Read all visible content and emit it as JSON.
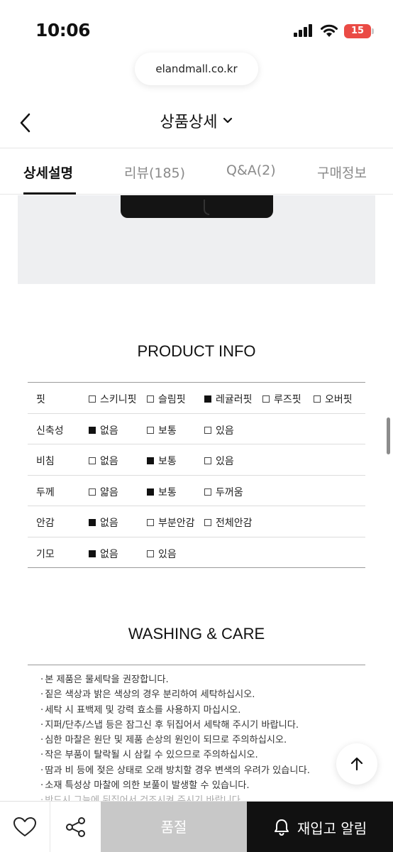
{
  "status_bar": {
    "time": "10:06",
    "battery": "15"
  },
  "browser": {
    "url": "elandmall.co.kr"
  },
  "header": {
    "title": "상품상세"
  },
  "tabs": [
    {
      "label": "상세설명",
      "active": true
    },
    {
      "label": "리뷰(185)",
      "active": false
    },
    {
      "label": "Q&A(2)",
      "active": false
    },
    {
      "label": "구매정보",
      "active": false
    }
  ],
  "product_info": {
    "title": "PRODUCT INFO",
    "rows": [
      {
        "label": "핏",
        "options": [
          {
            "text": "스키니핏",
            "checked": false
          },
          {
            "text": "슬림핏",
            "checked": false
          },
          {
            "text": "레귤러핏",
            "checked": true
          },
          {
            "text": "루즈핏",
            "checked": false
          },
          {
            "text": "오버핏",
            "checked": false
          }
        ]
      },
      {
        "label": "신축성",
        "options": [
          {
            "text": "없음",
            "checked": true
          },
          {
            "text": "보통",
            "checked": false
          },
          {
            "text": "있음",
            "checked": false
          }
        ]
      },
      {
        "label": "비침",
        "options": [
          {
            "text": "없음",
            "checked": false
          },
          {
            "text": "보통",
            "checked": true
          },
          {
            "text": "있음",
            "checked": false
          }
        ]
      },
      {
        "label": "두께",
        "options": [
          {
            "text": "얇음",
            "checked": false
          },
          {
            "text": "보통",
            "checked": true
          },
          {
            "text": "두꺼움",
            "checked": false
          }
        ]
      },
      {
        "label": "안감",
        "options": [
          {
            "text": "없음",
            "checked": true
          },
          {
            "text": "부분안감",
            "checked": false
          },
          {
            "text": "전체안감",
            "checked": false
          }
        ]
      },
      {
        "label": "기모",
        "options": [
          {
            "text": "없음",
            "checked": true
          },
          {
            "text": "있음",
            "checked": false
          }
        ]
      }
    ]
  },
  "washing": {
    "title": "WASHING & CARE",
    "items": [
      "본 제품은 물세탁을 권장합니다.",
      "짙은 색상과 밝은 색상의 경우 분리하여 세탁하십시오.",
      "세탁 시 표백제 및 강력 효소를 사용하지 마십시오.",
      "지퍼/단추/스냅 등은 잠그신 후 뒤집어서 세탁해 주시기 바랍니다.",
      "심한 마찰은 원단 및 제품 손상의 원인이 되므로 주의하십시오.",
      "작은 부품이 탈락될 시 삼킬 수 있으므로 주의하십시오.",
      "땀과 비 등에 젖은 상태로 오래 방치할 경우 변색의 우려가 있습니다.",
      "소재 특성상 마찰에 의한 보풀이 발생할 수 있습니다.",
      "반드시 그늘에 뒤집어서 건조시켜 주시기 바랍니다."
    ]
  },
  "bottom_bar": {
    "soldout_label": "품절",
    "restock_label": "재입고 알림"
  },
  "colors": {
    "accent": "#111111",
    "battery": "#ea4b45",
    "soldout": "#c8c8c8",
    "image_bg": "#eeeff1"
  }
}
